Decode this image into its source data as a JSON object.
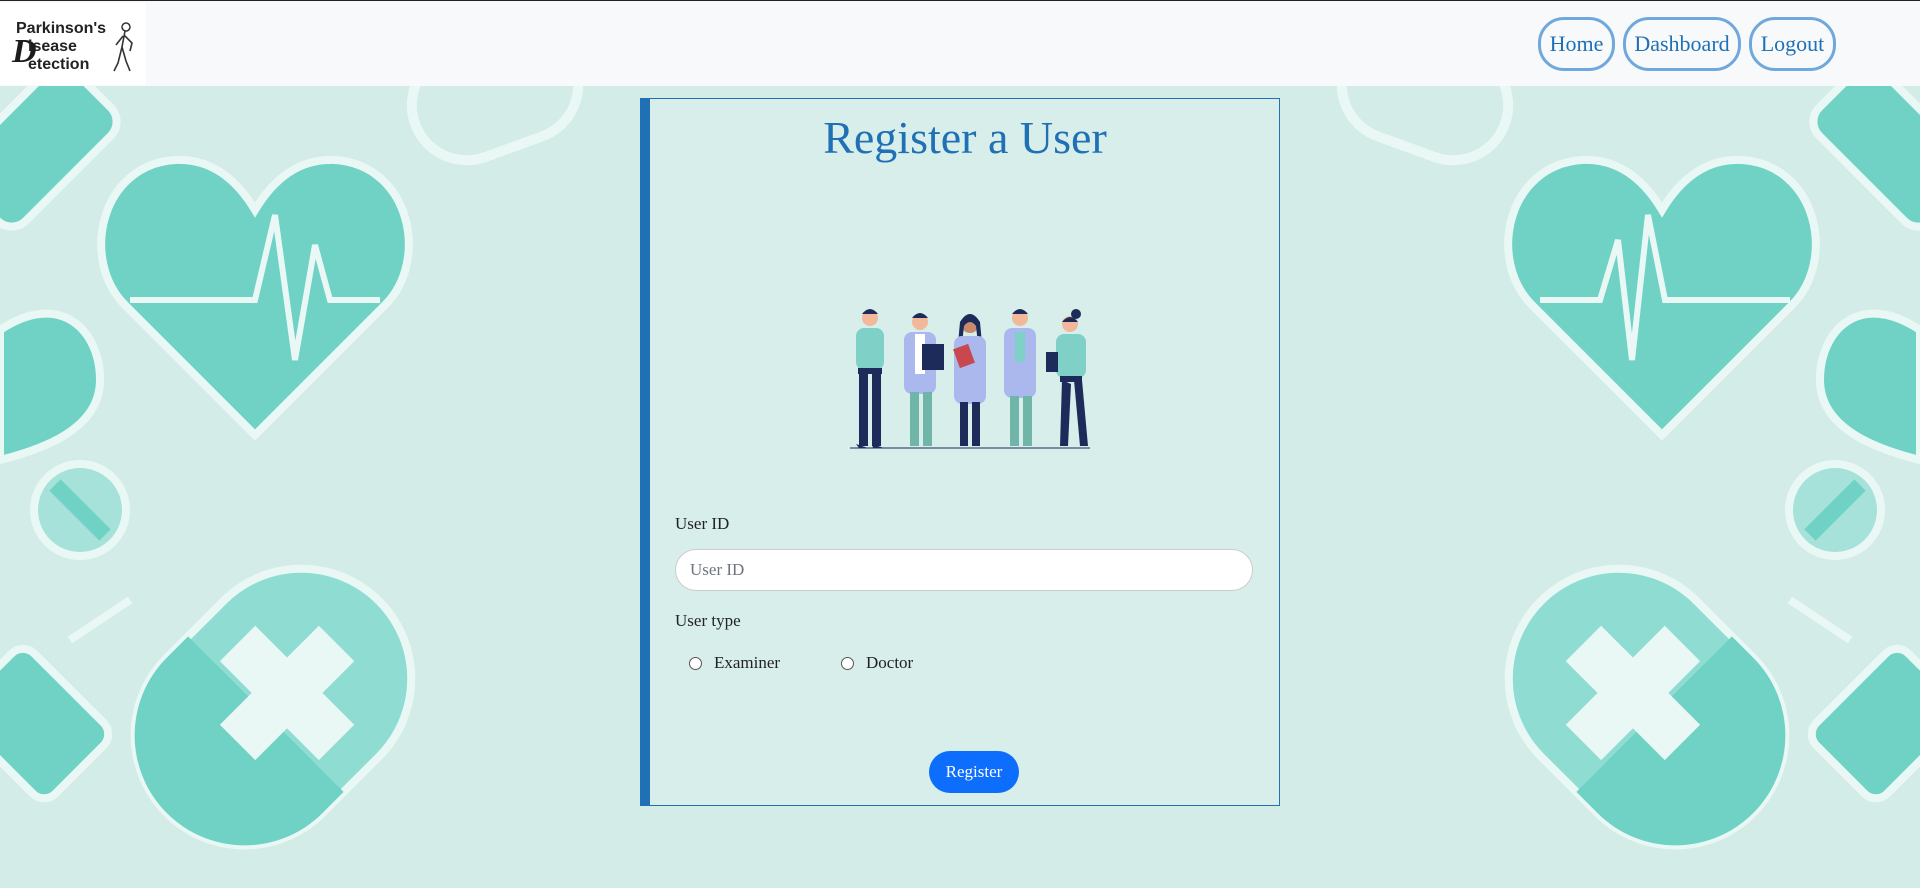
{
  "logo": {
    "line1": "Parkinson's",
    "big_letter": "D",
    "line2": "isease",
    "line3": "etection"
  },
  "nav": {
    "home": "Home",
    "dashboard": "Dashboard",
    "logout": "Logout"
  },
  "form": {
    "title": "Register a User",
    "user_id_label": "User ID",
    "user_id_placeholder": "User ID",
    "user_id_value": "",
    "user_type_label": "User type",
    "options": [
      "Examiner",
      "Doctor"
    ],
    "selected_option": "",
    "submit_label": "Register"
  },
  "colors": {
    "accent": "#1f70b5",
    "button": "#0d6efd",
    "background": "#d3ece8",
    "pattern": "#6fd2c4"
  }
}
